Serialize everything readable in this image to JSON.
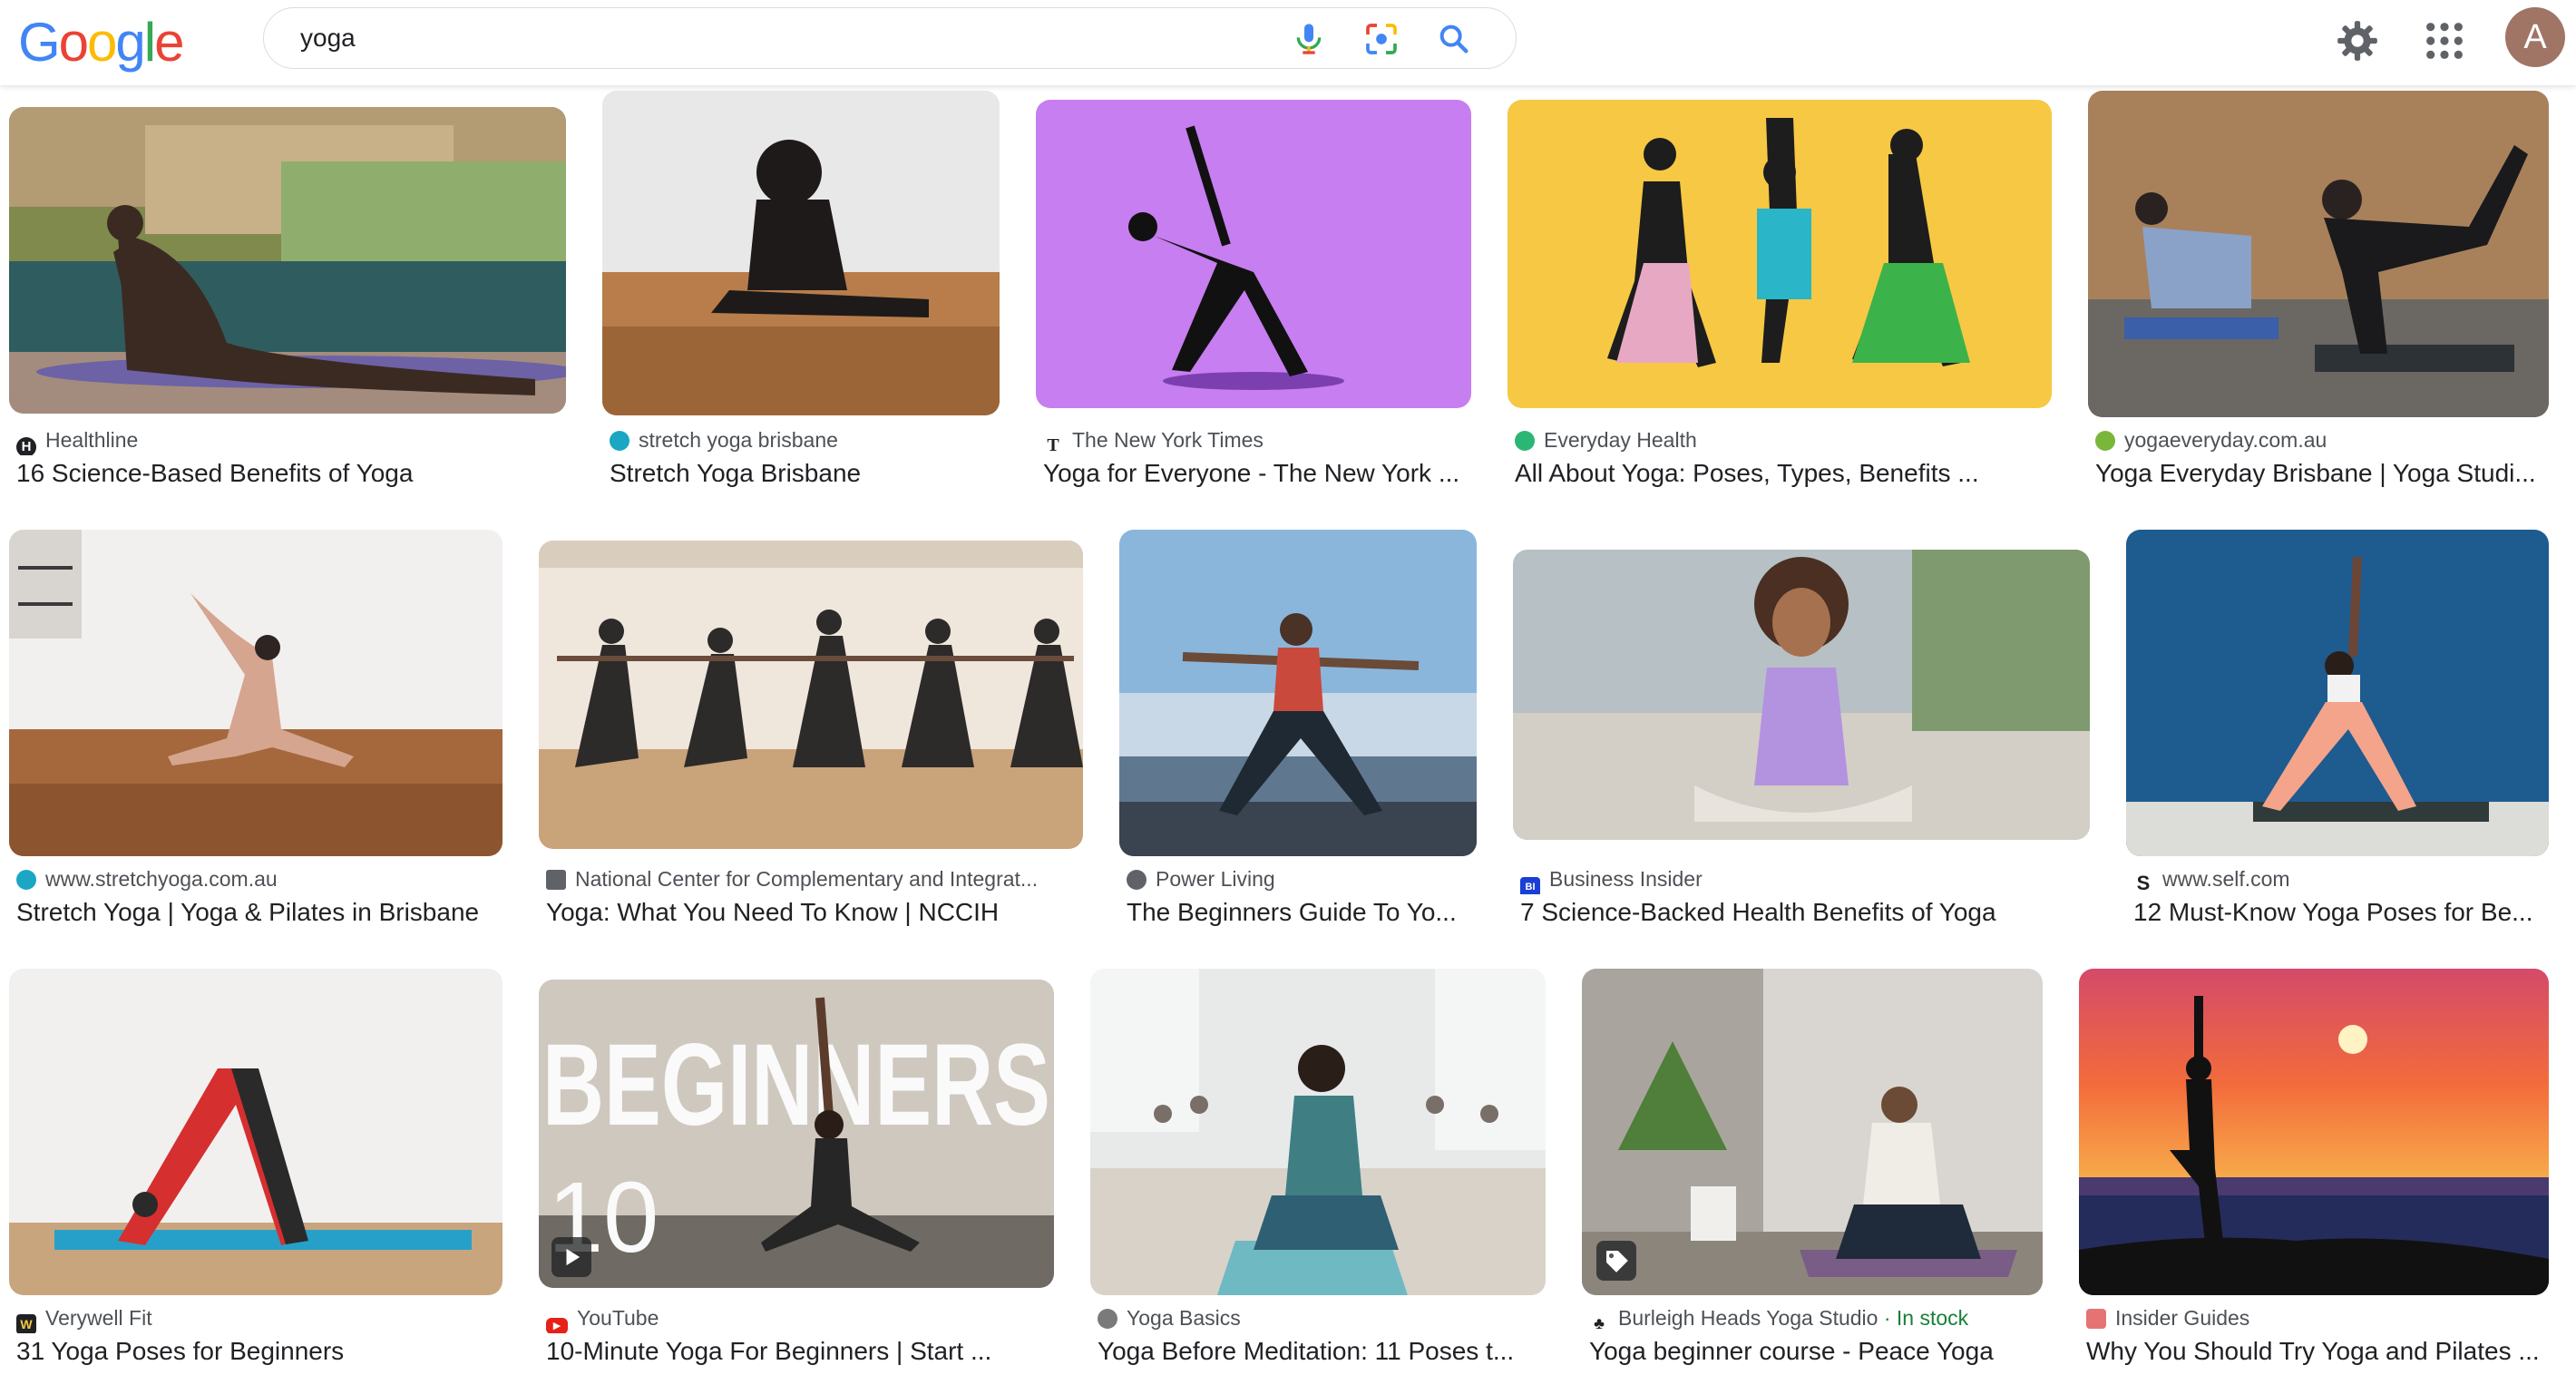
{
  "search": {
    "query": "yoga"
  },
  "header": {
    "avatar_letter": "A"
  },
  "results": [
    {
      "source": "Healthline",
      "title": "16 Science-Based Benefits of Yoga",
      "favicon_color": "#202124"
    },
    {
      "source": "stretch yoga brisbane",
      "title": "Stretch Yoga Brisbane",
      "favicon_color": "#1aa7c4"
    },
    {
      "source": "The New York Times",
      "title": "Yoga for Everyone - The New York ...",
      "favicon_color": "#202124"
    },
    {
      "source": "Everyday Health",
      "title": "All About Yoga: Poses, Types, Benefits ...",
      "favicon_color": "#2bb673"
    },
    {
      "source": "yogaeveryday.com.au",
      "title": "Yoga Everyday Brisbane | Yoga Studi...",
      "favicon_color": "#7ab63a"
    },
    {
      "source": "www.stretchyoga.com.au",
      "title": "Stretch Yoga | Yoga & Pilates in Brisbane",
      "favicon_color": "#1aa7c4"
    },
    {
      "source": "National Center for Complementary and Integrat...",
      "title": "Yoga: What You Need To Know | NCCIH",
      "favicon_color": "#5f6368"
    },
    {
      "source": "Power Living",
      "title": "The Beginners Guide To Yo...",
      "favicon_color": "#5f6368"
    },
    {
      "source": "Business Insider",
      "title": "7 Science-Backed Health Benefits of Yoga",
      "favicon_color": "#1a3fd6"
    },
    {
      "source": "www.self.com",
      "title": "12 Must-Know Yoga Poses for Be...",
      "favicon_color": "#202124"
    },
    {
      "source": "Verywell Fit",
      "title": "31 Yoga Poses for Beginners",
      "favicon_color": "#202124"
    },
    {
      "source": "YouTube",
      "title": "10-Minute Yoga For Beginners | Start ...",
      "favicon_color": "#e62117"
    },
    {
      "source": "Yoga Basics",
      "title": "Yoga Before Meditation: 11 Poses t...",
      "favicon_color": "#7a7a7a"
    },
    {
      "source": "Burleigh Heads Yoga Studio",
      "source_extra": " · In stock",
      "title": "Yoga beginner course - Peace Yoga",
      "favicon_color": "#202124"
    },
    {
      "source": "Insider Guides",
      "title": "Why You Should Try Yoga and Pilates ...",
      "favicon_color": "#e57373"
    }
  ],
  "thumb_text": {
    "beginners": "BEGINNERS",
    "ten": "10"
  }
}
